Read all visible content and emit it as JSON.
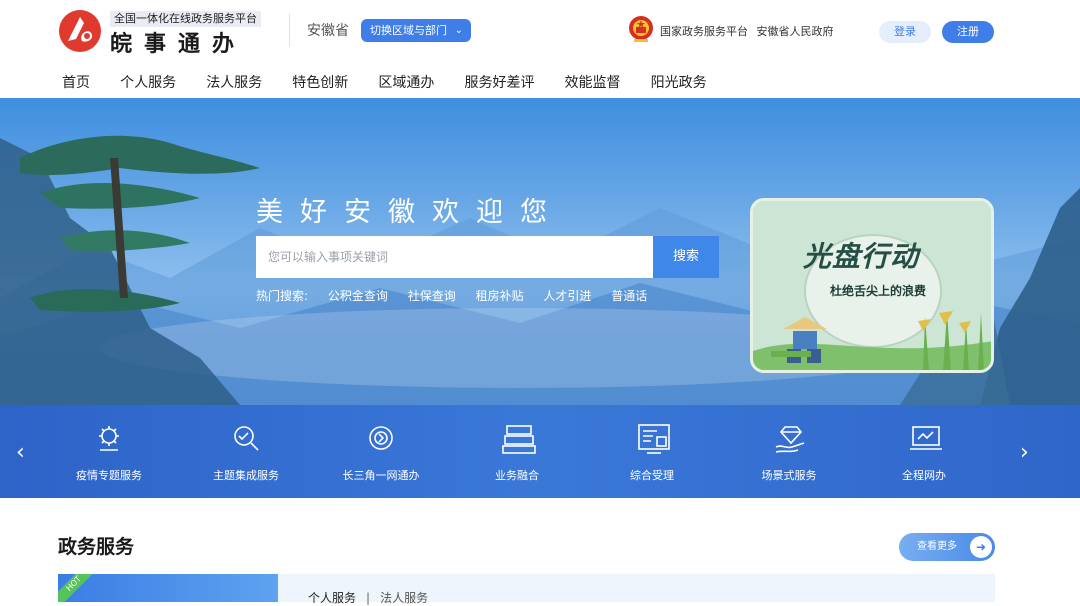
{
  "header": {
    "logo_subtitle": "全国一体化在线政务服务平台",
    "logo_name": "皖事通办",
    "province": "安徽省",
    "switch_region_label": "切换区域与部门",
    "gov_links": [
      "国家政务服务平台",
      "安徽省人民政府"
    ],
    "login_label": "登录",
    "register_label": "注册"
  },
  "nav": {
    "items": [
      "首页",
      "个人服务",
      "法人服务",
      "特色创新",
      "区域通办",
      "服务好差评",
      "效能监督",
      "阳光政务"
    ]
  },
  "hero": {
    "title": "美好安徽欢迎您",
    "search_placeholder": "您可以输入事项关键词",
    "search_button": "搜索",
    "hot_label": "热门搜索:",
    "hot_terms": [
      "公积金查询",
      "社保查询",
      "租房补贴",
      "人才引进",
      "普通话"
    ],
    "promo_title": "光盘行动",
    "promo_subtitle": "杜绝舌尖上的浪费"
  },
  "services": {
    "items": [
      {
        "label": "疫情专题服务",
        "icon": "virus-icon"
      },
      {
        "label": "主题集成服务",
        "icon": "magnifier-icon"
      },
      {
        "label": "长三角一网通办",
        "icon": "globe-icon"
      },
      {
        "label": "业务融合",
        "icon": "stack-icon"
      },
      {
        "label": "综合受理",
        "icon": "form-icon"
      },
      {
        "label": "场景式服务",
        "icon": "diamond-hand-icon"
      },
      {
        "label": "全程网办",
        "icon": "laptop-icon"
      }
    ],
    "prev": "‹",
    "next": "›"
  },
  "section": {
    "title": "政务服务",
    "more_label": "查看更多",
    "more_arrow": "➜",
    "hot_badge": "HOT",
    "tabs": [
      "个人服务",
      "法人服务"
    ],
    "tab_separator": "|"
  },
  "colors": {
    "brand_blue": "#3f7ee8",
    "logo_red": "#e03a2f",
    "service_bar": "#3a78d8"
  }
}
